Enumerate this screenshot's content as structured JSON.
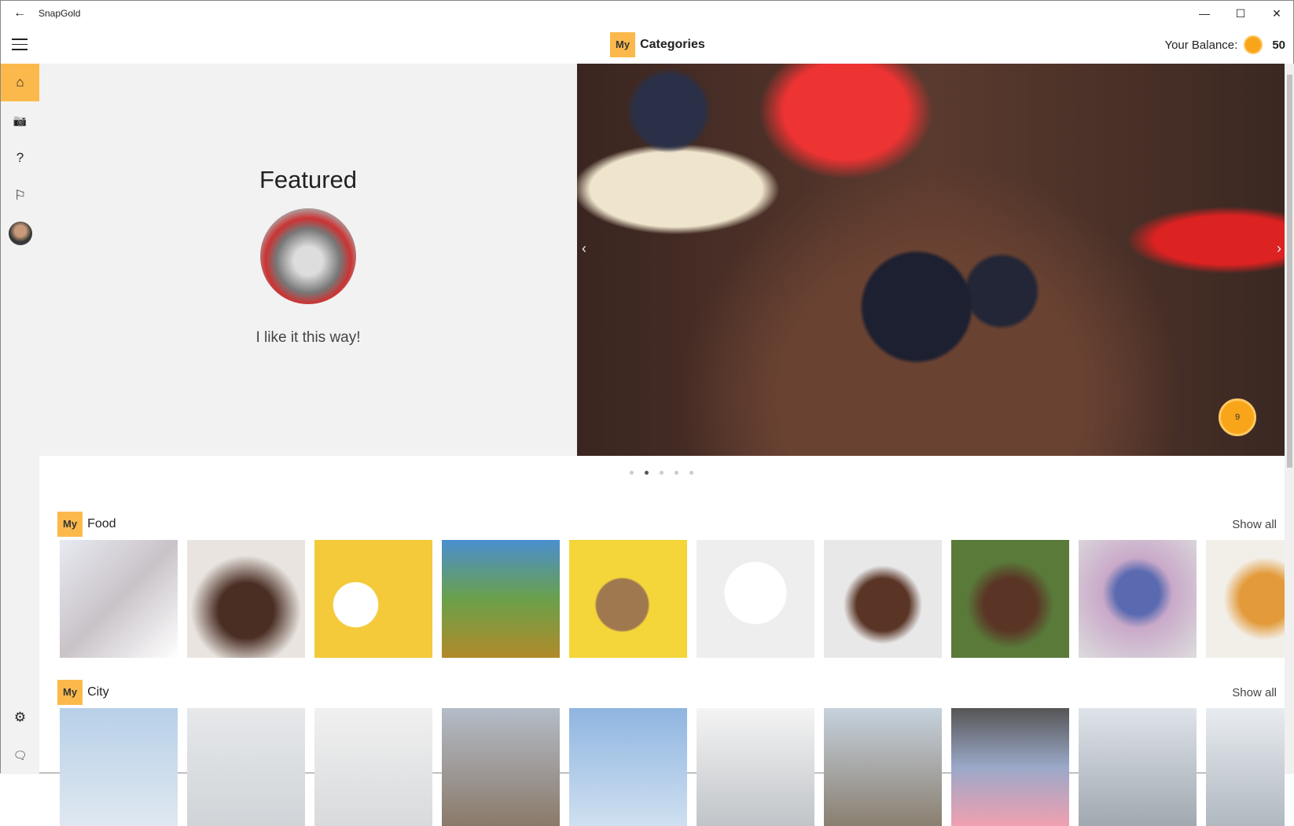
{
  "window": {
    "title": "SnapGold",
    "back": "←",
    "minimize": "—",
    "maximize": "☐",
    "close": "✕"
  },
  "header": {
    "my": "My",
    "title": "Categories",
    "balance_label": "Your Balance:",
    "balance_value": "50",
    "coin_color": "#f9a51a"
  },
  "sidebar": {
    "items": [
      {
        "name": "home",
        "icon": "⌂"
      },
      {
        "name": "camera",
        "icon": "📷"
      },
      {
        "name": "help",
        "icon": "?"
      },
      {
        "name": "flag",
        "icon": "⚐"
      }
    ],
    "settings_icon": "⚙",
    "feedback_icon": "🗨"
  },
  "featured": {
    "title": "Featured",
    "caption": "I like it this way!"
  },
  "carousel": {
    "prev": "‹",
    "next": "›",
    "badge": "9",
    "active_dot": 1,
    "dot_count": 5
  },
  "sections": [
    {
      "my": "My",
      "name": "Food",
      "show_all": "Show all",
      "tiles": [
        "linear-gradient(135deg,#e8eaf2,#c9c3c8 50%,#fff)",
        "radial-gradient(circle at 50% 60%,#4a2e24 30%,#e9e4df 60%)",
        "radial-gradient(circle at 35% 55%,#fff 0 22%,#f4c93a 23%)",
        "linear-gradient(180deg,#4a8fd0,#6aa04a 50%,#b18a2a)",
        "radial-gradient(ellipse at 45% 55%,#a07850 0 28%,#f4d53a 30%)",
        "radial-gradient(circle at 50% 45%,#fff 0 35%,#eee 36%)",
        "radial-gradient(circle at 50% 55%,#5a3526 0 30%,#e8e8e8 45%)",
        "radial-gradient(circle at 50% 55%,#5a3526 0 30%,#5a7a3a 50%)",
        "radial-gradient(circle at 50% 45%,#5a6ab0 0 25%,#c9a9c9 40%,#ddd)",
        "radial-gradient(circle,#e39a3a 0 30%,#f2efe9 50%)"
      ]
    },
    {
      "my": "My",
      "name": "City",
      "show_all": "Show all",
      "tiles": [
        "linear-gradient(180deg,#b8d0e8,#dfe8f0)",
        "linear-gradient(180deg,#e6e8ea,#d0d4d8)",
        "linear-gradient(180deg,#f0f0f0,#d8dadc)",
        "linear-gradient(180deg,#b4bcc8,#8a7a6a)",
        "linear-gradient(180deg,#8fb5e0,#cfe0f0)",
        "linear-gradient(180deg,#f4f4f4,#c0c4c8)",
        "linear-gradient(180deg,#c6d2de,#8a7f70)",
        "linear-gradient(180deg,#555,#9aa8c8 50%,#f0a0b0)",
        "linear-gradient(180deg,#dfe4ea,#a0a8b0)",
        "linear-gradient(180deg,#e8ecf0,#b0b8c0)"
      ]
    }
  ]
}
